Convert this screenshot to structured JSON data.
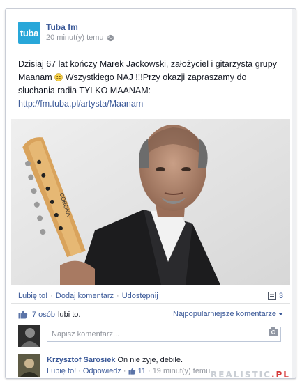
{
  "post": {
    "page_name": "Tuba fm",
    "avatar_text": "tuba",
    "time": "20 minut(y) temu",
    "text_line1": "Dzisiaj 67 lat kończy Marek Jackowski, założyciel i gitarzysta grupy",
    "text_line2a": "Maanam",
    "text_line2b": " Wszystkiego NAJ !!!Przy okazji zapraszamy do",
    "text_line3": "słuchania radia TYLKO MAANAM:",
    "link": "http://fm.tuba.pl/artysta/Maanam",
    "guitar_label": "CORONA"
  },
  "actions": {
    "like": "Lubię to!",
    "comment": "Dodaj komentarz",
    "share": "Udostępnij",
    "comment_count": "3"
  },
  "likes": {
    "count": "7 osób",
    "suffix": "lubi to.",
    "sort_label": "Najpopularniejsze komentarze"
  },
  "composer": {
    "placeholder": "Napisz komentarz..."
  },
  "comment": {
    "author": "Krzysztof Sarosiek",
    "text": "On nie żyje, debile.",
    "like": "Lubię to!",
    "reply": "Odpowiedz",
    "like_count": "11",
    "time": "19 minut(y) temu"
  },
  "watermark": {
    "main": "REALISTIC",
    "suffix": ".PL"
  },
  "colors": {
    "brand": "#3b5998",
    "tuba": "#28a7d9"
  }
}
